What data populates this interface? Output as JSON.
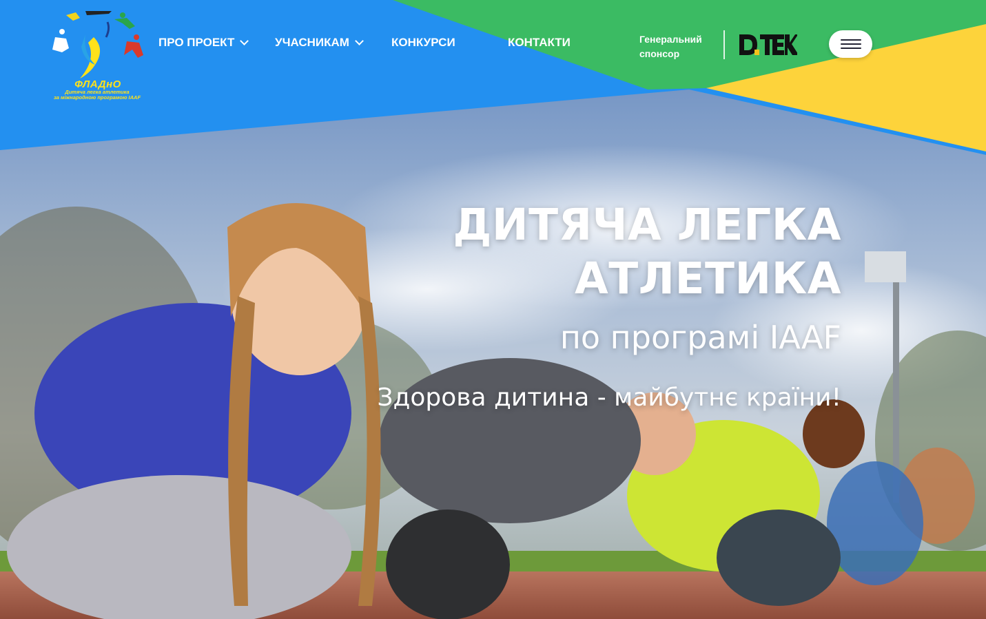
{
  "logo": {
    "title": "ФЛАДнО",
    "subtitle_line1": "Дитяча легка атлетика",
    "subtitle_line2": "за міжнародною програмою IAAF"
  },
  "nav": {
    "items": [
      {
        "label": "ПРО ПРОЕКТ",
        "has_dropdown": true
      },
      {
        "label": "УЧАСНИКАМ",
        "has_dropdown": true
      },
      {
        "label": "КОНКУРСИ",
        "has_dropdown": false
      },
      {
        "label": "КОНТАКТИ",
        "has_dropdown": false
      }
    ]
  },
  "sponsor": {
    "label_line1": "Генеральний",
    "label_line2": "спонсор",
    "brand": "D.TEK"
  },
  "hero": {
    "title_line1": "ДИТЯЧА ЛЕГКА",
    "title_line2": "АТЛЕТИКА",
    "subtitle": "по програмі IAAF",
    "slogan": "Здорова дитина - майбутнє країни!"
  },
  "colors": {
    "blue": "#2390f0",
    "green": "#3bbb63",
    "yellow": "#fdd33b",
    "white": "#ffffff",
    "logo_text": "#ffe21a"
  },
  "icons": {
    "menu": "hamburger-icon",
    "dropdown": "chevron-down-icon"
  }
}
